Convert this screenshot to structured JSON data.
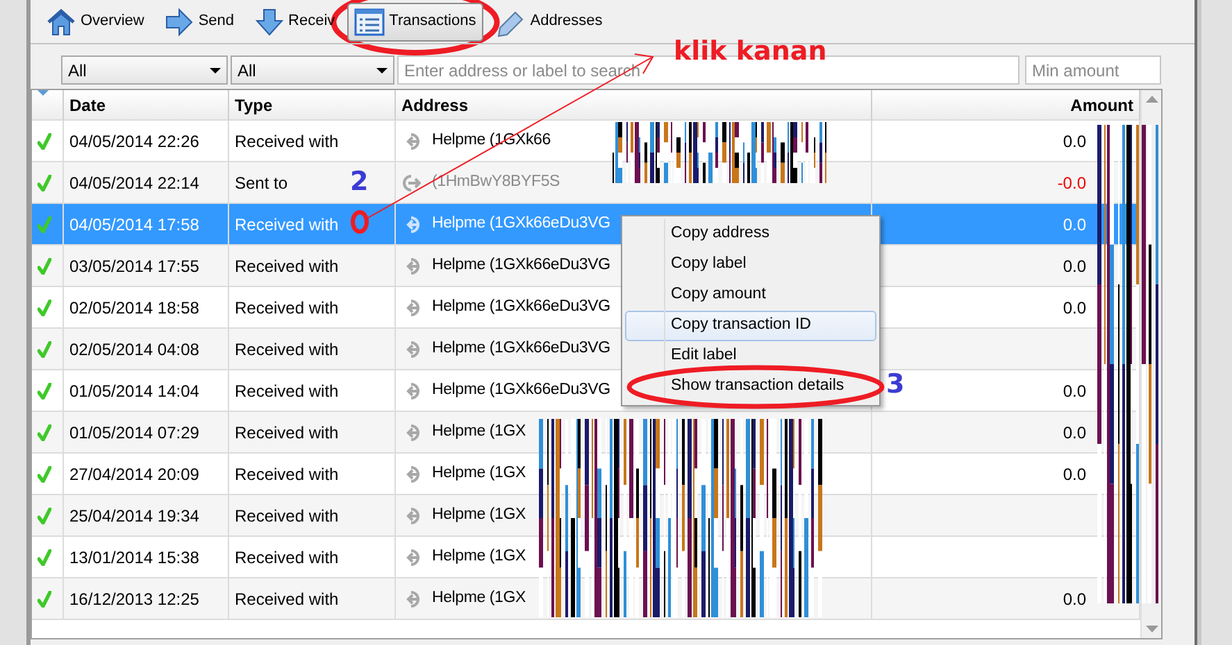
{
  "toolbar": [
    {
      "label": "Overview",
      "selected": false
    },
    {
      "label": "Send",
      "selected": false
    },
    {
      "label": "Receiv",
      "selected": false
    },
    {
      "label": "Transactions",
      "selected": true
    },
    {
      "label": "Addresses",
      "selected": false
    }
  ],
  "filters": {
    "date": "All",
    "type": "All",
    "search": {
      "placeholder": "Enter address or label to search"
    },
    "min_amount": {
      "placeholder": "Min amount"
    }
  },
  "table": {
    "columns": [
      "Date",
      "Type",
      "Address",
      "Amount"
    ],
    "rows": [
      {
        "kind": "received",
        "confirmed": true,
        "selected": false,
        "date": "04/05/2014 22:26",
        "type": "Received with",
        "address": "Helpme (1GXk66",
        "amount": "0.0"
      },
      {
        "kind": "sent",
        "confirmed": true,
        "selected": false,
        "date": "04/05/2014 22:14",
        "type": "Sent to",
        "address": "(1HmBwY8BYF5S",
        "amount": "-0.0"
      },
      {
        "kind": "received",
        "confirmed": true,
        "selected": true,
        "date": "04/05/2014 17:58",
        "type": "Received with",
        "address": "Helpme (1GXk66eDu3VG",
        "amount": "0.0"
      },
      {
        "kind": "received",
        "confirmed": true,
        "selected": false,
        "date": "03/05/2014 17:55",
        "type": "Received with",
        "address": "Helpme (1GXk66eDu3VG",
        "amount": "0.0"
      },
      {
        "kind": "received",
        "confirmed": true,
        "selected": false,
        "date": "02/05/2014 18:58",
        "type": "Received with",
        "address": "Helpme (1GXk66eDu3VG",
        "amount": "0.0"
      },
      {
        "kind": "received",
        "confirmed": true,
        "selected": false,
        "date": "02/05/2014 04:08",
        "type": "Received with",
        "address": "Helpme (1GXk66eDu3VG"
      },
      {
        "kind": "received",
        "confirmed": true,
        "selected": false,
        "date": "01/05/2014 14:04",
        "type": "Received with",
        "address": "Helpme (1GXk66eDu3VG",
        "amount": "0.0"
      },
      {
        "kind": "received",
        "confirmed": true,
        "selected": false,
        "date": "01/05/2014 07:29",
        "type": "Received with",
        "address": "Helpme (1GX",
        "amount": "0.0"
      },
      {
        "kind": "received",
        "confirmed": true,
        "selected": false,
        "date": "27/04/2014 20:09",
        "type": "Received with",
        "address": "Helpme (1GX",
        "amount": "0.0"
      },
      {
        "kind": "received",
        "confirmed": true,
        "selected": false,
        "date": "25/04/2014 19:34",
        "type": "Received with",
        "address": "Helpme (1GX"
      },
      {
        "kind": "received",
        "confirmed": true,
        "selected": false,
        "date": "13/01/2014 15:38",
        "type": "Received with",
        "address": "Helpme (1GX"
      },
      {
        "kind": "received",
        "confirmed": true,
        "selected": false,
        "date": "16/12/2013 12:25",
        "type": "Received with",
        "address": "Helpme (1GX",
        "amount": "0.0"
      }
    ]
  },
  "context_menu": [
    {
      "label": "Copy address",
      "selected": false
    },
    {
      "label": "Copy label",
      "selected": false
    },
    {
      "label": "Copy amount",
      "selected": false
    },
    {
      "label": "Copy transaction ID",
      "selected": true
    },
    {
      "label": "Edit label",
      "selected": false
    },
    {
      "label": "Show transaction details",
      "selected": false
    }
  ],
  "annotations": {
    "note": "klik kanan",
    "step_2": "2",
    "step_3": "3"
  }
}
